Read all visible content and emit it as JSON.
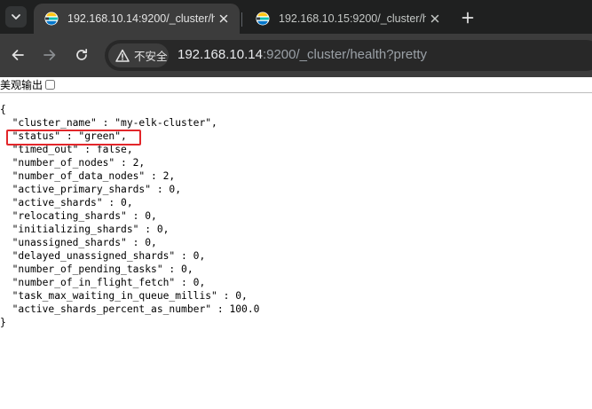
{
  "tabs": [
    {
      "title": "192.168.10.14:9200/_cluster/h",
      "active": true
    },
    {
      "title": "192.168.10.15:9200/_cluster/h",
      "active": false
    }
  ],
  "icons": {
    "tab_search": "chevron-down-icon",
    "favicon": "elastic-logo-icon",
    "close": "close-icon",
    "new_tab": "plus-icon",
    "back": "back-arrow-icon",
    "forward": "forward-arrow-icon",
    "reload": "reload-icon",
    "security": "not-secure-icon"
  },
  "colors": {
    "highlight": "#e2262a",
    "tab_bar": "#1f2020",
    "toolbar": "#3c3c3c"
  },
  "toolbar": {
    "security_label": "不安全",
    "url_host": "192.168.10.14",
    "url_rest": ":9200/_cluster/health?pretty"
  },
  "page": {
    "pretty_print_label": "美观输出",
    "pretty_print_checked": false,
    "json_lines": [
      "{",
      "  \"cluster_name\" : \"my-elk-cluster\",",
      "  \"status\" : \"green\",",
      "  \"timed_out\" : false,",
      "  \"number_of_nodes\" : 2,",
      "  \"number_of_data_nodes\" : 2,",
      "  \"active_primary_shards\" : 0,",
      "  \"active_shards\" : 0,",
      "  \"relocating_shards\" : 0,",
      "  \"initializing_shards\" : 0,",
      "  \"unassigned_shards\" : 0,",
      "  \"delayed_unassigned_shards\" : 0,",
      "  \"number_of_pending_tasks\" : 0,",
      "  \"number_of_in_flight_fetch\" : 0,",
      "  \"task_max_waiting_in_queue_millis\" : 0,",
      "  \"active_shards_percent_as_number\" : 100.0",
      "}"
    ]
  }
}
